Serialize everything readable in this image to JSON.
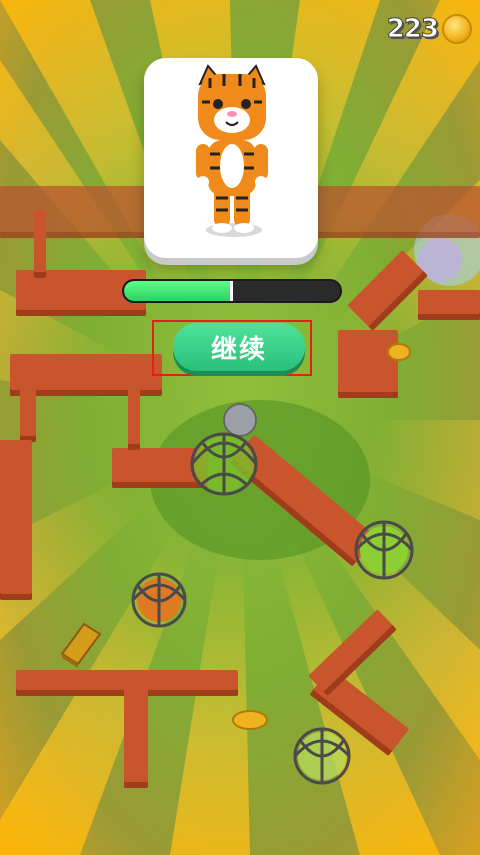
{
  "hud": {
    "coin_count": "223",
    "coin_icon": "gold-coin-icon"
  },
  "reward_card": {
    "character": "tiger-character",
    "icon": "tiger-character-icon"
  },
  "progress": {
    "fill_fraction": 0.49,
    "fill_color": "#36e06a"
  },
  "continue_button": {
    "label": "继续",
    "color": "#33cc85"
  },
  "colors": {
    "grass": "#7fae33",
    "wall": "#c8552b",
    "ray": "#f5c230",
    "highlight": "#e0221b"
  }
}
